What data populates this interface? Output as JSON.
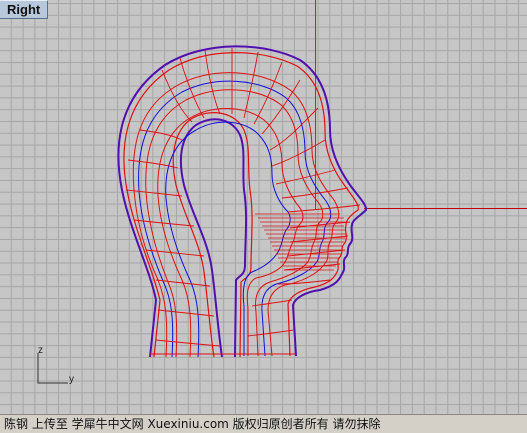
{
  "viewport": {
    "title": "Right"
  },
  "axes_triad": {
    "z_label": "z",
    "y_label": "y"
  },
  "colors": {
    "grid_background": "#c6c6c6",
    "grid_line": "#a6a6a6",
    "x_axis": "#c00000",
    "z_axis": "#0a8a0a",
    "isocurve_red": "#e01010",
    "isocurve_blue": "#1010e0",
    "outline_purple": "#6010a0"
  },
  "watermark": {
    "text": "陈钢 上传至 学犀牛中文网 Xuexiniu.com 版权归原创者所有 请勿抹除"
  }
}
